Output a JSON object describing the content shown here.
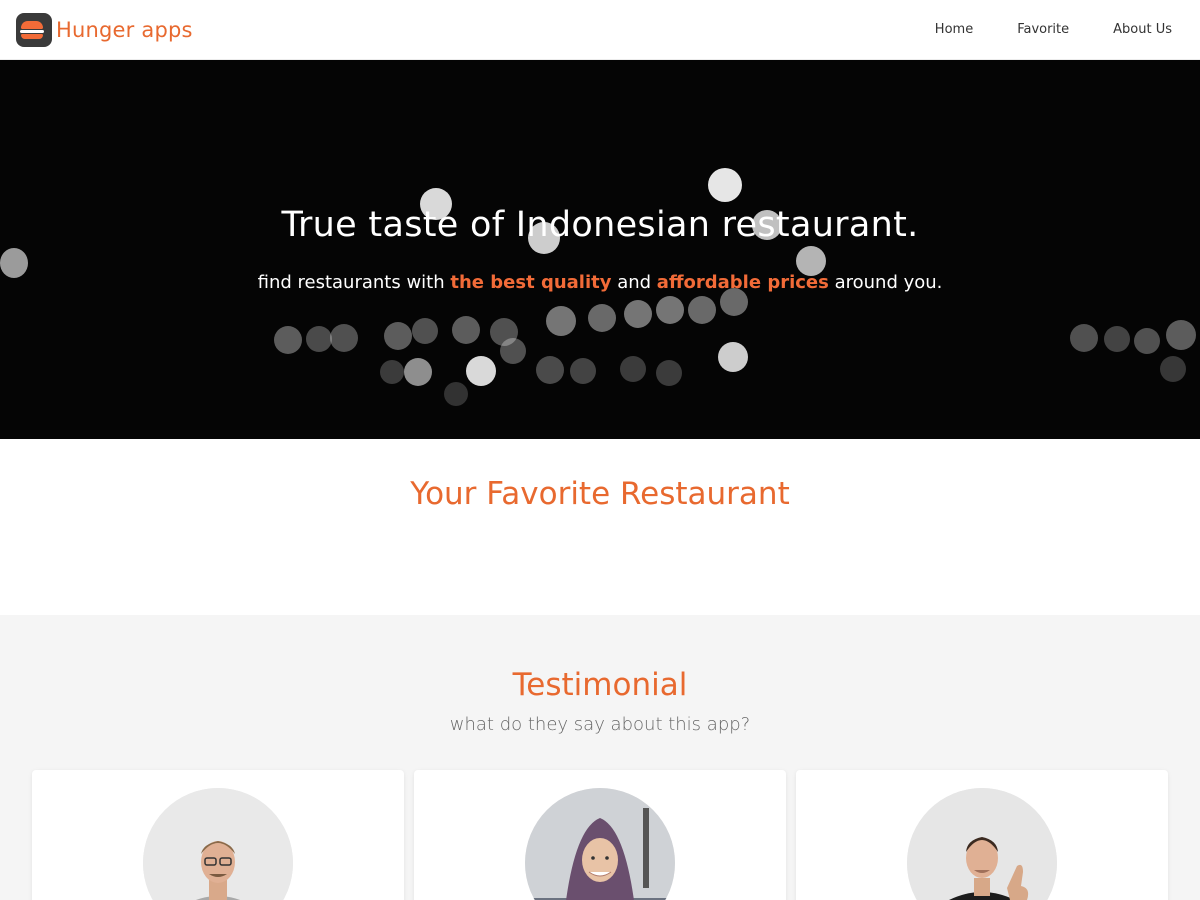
{
  "header": {
    "brand": "Hunger apps",
    "logo_icon": "burger-icon",
    "nav": [
      {
        "label": "Home"
      },
      {
        "label": "Favorite"
      },
      {
        "label": "About Us"
      }
    ]
  },
  "hero": {
    "title": "True taste of Indonesian restaurant.",
    "subtitle_part1": "find restaurants with ",
    "highlight1": "the best quality",
    "subtitle_part2": " and ",
    "highlight2": "affordable prices",
    "subtitle_part3": " around you."
  },
  "favorite": {
    "title": "Your Favorite Restaurant"
  },
  "testimonial": {
    "title": "Testimonial",
    "subtitle": "what do they say about this app?",
    "cards": [
      {
        "avatar": "man-with-glasses-photo"
      },
      {
        "avatar": "woman-in-hijab-photo"
      },
      {
        "avatar": "man-thumbs-up-photo"
      }
    ]
  },
  "colors": {
    "accent": "#e8692f",
    "hero_bg": "#050505",
    "section_bg": "#f5f5f5"
  }
}
